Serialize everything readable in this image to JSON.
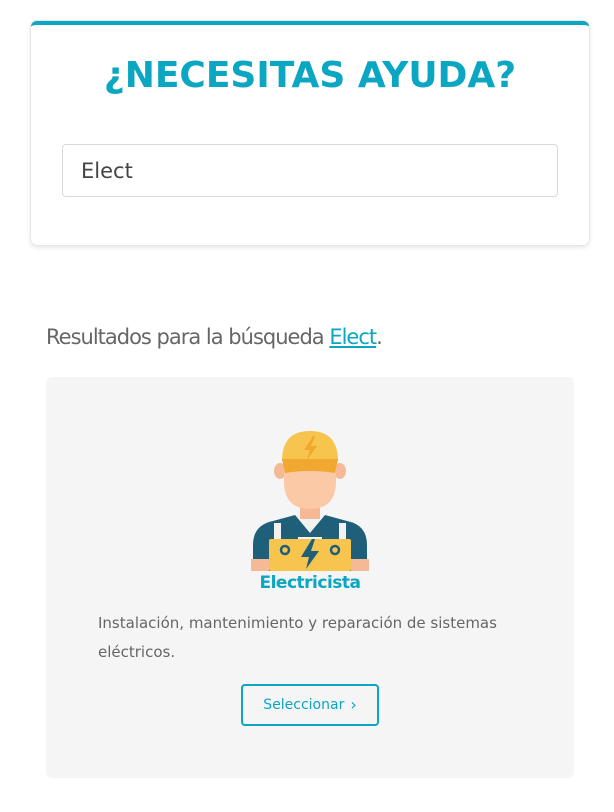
{
  "search": {
    "title": "¿NECESITAS AYUDA?",
    "value": "Elect"
  },
  "results": {
    "prefix": "Resultados para la búsqueda ",
    "query": "Elect",
    "suffix": "."
  },
  "result": {
    "icon": "electrician-icon",
    "title": "Electricista",
    "description": "Instalación, mantenimiento y reparación de sistemas eléctricos.",
    "button_label": "Seleccionar",
    "button_icon": "chevron-right-icon"
  },
  "colors": {
    "accent": "#0aa6c2",
    "card_background": "#f5f5f5",
    "text_muted": "#666666"
  }
}
